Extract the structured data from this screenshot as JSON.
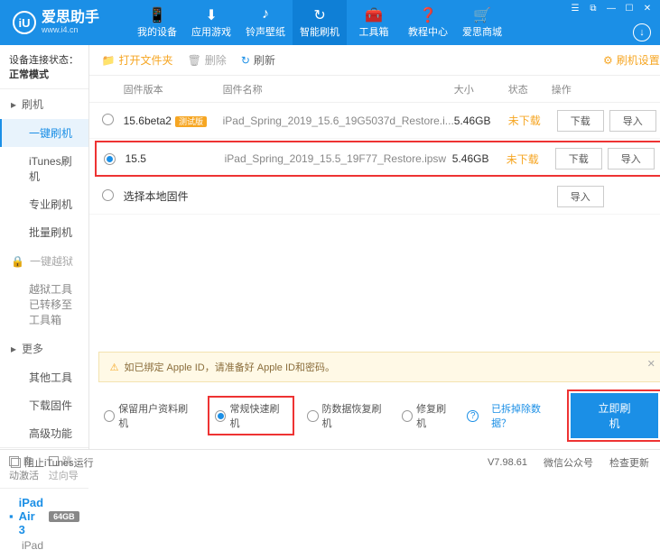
{
  "app": {
    "name": "爱思助手",
    "sub": "www.i4.cn"
  },
  "navs": [
    {
      "label": "我的设备",
      "icon": "📱"
    },
    {
      "label": "应用游戏",
      "icon": "⬇"
    },
    {
      "label": "铃声壁纸",
      "icon": "♪"
    },
    {
      "label": "智能刷机",
      "icon": "↻",
      "active": true
    },
    {
      "label": "工具箱",
      "icon": "🧰"
    },
    {
      "label": "教程中心",
      "icon": "❓"
    },
    {
      "label": "爱思商城",
      "icon": "🛒"
    }
  ],
  "conn": {
    "label": "设备连接状态：",
    "value": "正常模式"
  },
  "menu": {
    "g1": {
      "title": "刷机",
      "items": [
        "一键刷机",
        "iTunes刷机",
        "专业刷机",
        "批量刷机"
      ],
      "active": 0
    },
    "g2": {
      "title": "一键越狱",
      "items": [
        "越狱工具已转移至工具箱"
      ]
    },
    "g3": {
      "title": "更多",
      "items": [
        "其他工具",
        "下载固件",
        "高级功能"
      ]
    }
  },
  "chk": {
    "auto": "自动激活",
    "skip": "跳过向导"
  },
  "device": {
    "name": "iPad Air 3",
    "cap": "64GB",
    "type": "iPad"
  },
  "toolbar": {
    "open": "打开文件夹",
    "del": "删除",
    "refresh": "刷新",
    "setting": "刷机设置"
  },
  "thead": {
    "ver": "固件版本",
    "name": "固件名称",
    "size": "大小",
    "stat": "状态",
    "ops": "操作"
  },
  "rows": [
    {
      "ver": "15.6beta2",
      "tag": "测试版",
      "name": "iPad_Spring_2019_15.6_19G5037d_Restore.i...",
      "size": "5.46GB",
      "stat": "未下载",
      "sel": false
    },
    {
      "ver": "15.5",
      "name": "iPad_Spring_2019_15.5_19F77_Restore.ipsw",
      "size": "5.46GB",
      "stat": "未下载",
      "sel": true
    }
  ],
  "localrow": {
    "label": "选择本地固件",
    "btn": "导入"
  },
  "btns": {
    "dl": "下载",
    "imp": "导入"
  },
  "warn": "如已绑定 Apple ID，请准备好 Apple ID和密码。",
  "opts": {
    "a": "保留用户资料刷机",
    "b": "常规快速刷机",
    "c": "防数据恢复刷机",
    "d": "修复刷机",
    "link": "已拆掉除数据？",
    "go": "立即刷机"
  },
  "footer": {
    "block": "阻止iTunes运行",
    "ver": "V7.98.61",
    "wx": "微信公众号",
    "upd": "检查更新"
  }
}
